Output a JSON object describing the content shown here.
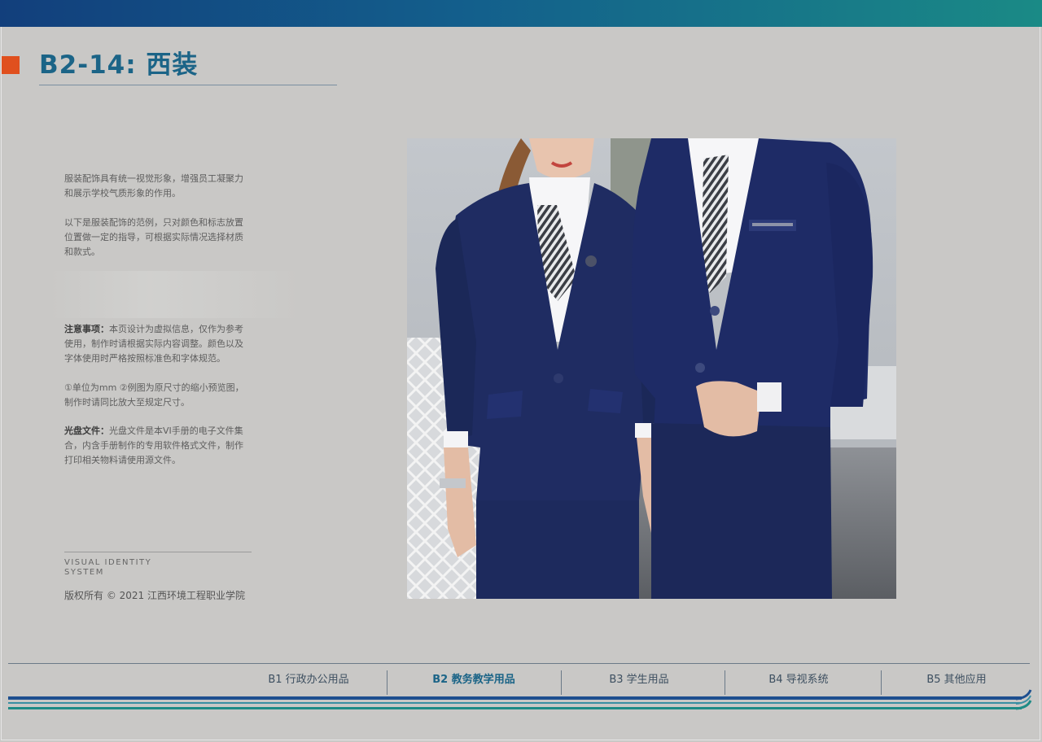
{
  "page": {
    "title": "B2-14: 西装",
    "accent_color": "#e0501e",
    "brand_color": "#1b6487"
  },
  "description": {
    "para1": "服装配饰具有统一视觉形象，增强员工凝聚力和展示学校气质形象的作用。",
    "para2": "以下是服装配饰的范例，只对颜色和标志放置位置做一定的指导，可根据实际情况选择材质和款式。",
    "notice_label": "注意事项：",
    "notice_text": "本页设计为虚拟信息，仅作为参考使用，制作时请根据实际内容调整。颜色以及字体使用时严格按照标准色和字体规范。",
    "units_text": "①单位为mm ②例图为原尺寸的缩小预览图，制作时请同比放大至规定尺寸。",
    "disc_label": "光盘文件：",
    "disc_text": "光盘文件是本VI手册的电子文件集合，内含手册制作的专用软件格式文件，制作打印相关物料请使用源文件。"
  },
  "footer": {
    "vi_line1": "VISUAL IDENTITY",
    "vi_line2": "SYSTEM",
    "copyright": "版权所有 © 2021 江西环境工程职业学院"
  },
  "nav": {
    "items": [
      {
        "label": "B1 行政办公用品",
        "active": false
      },
      {
        "label": "B2 教务教学用品",
        "active": true
      },
      {
        "label": "B3 学生用品",
        "active": false
      },
      {
        "label": "B4 导视系统",
        "active": false
      },
      {
        "label": "B5 其他应用",
        "active": false
      }
    ]
  },
  "photo": {
    "icon": "uniform-photo"
  }
}
